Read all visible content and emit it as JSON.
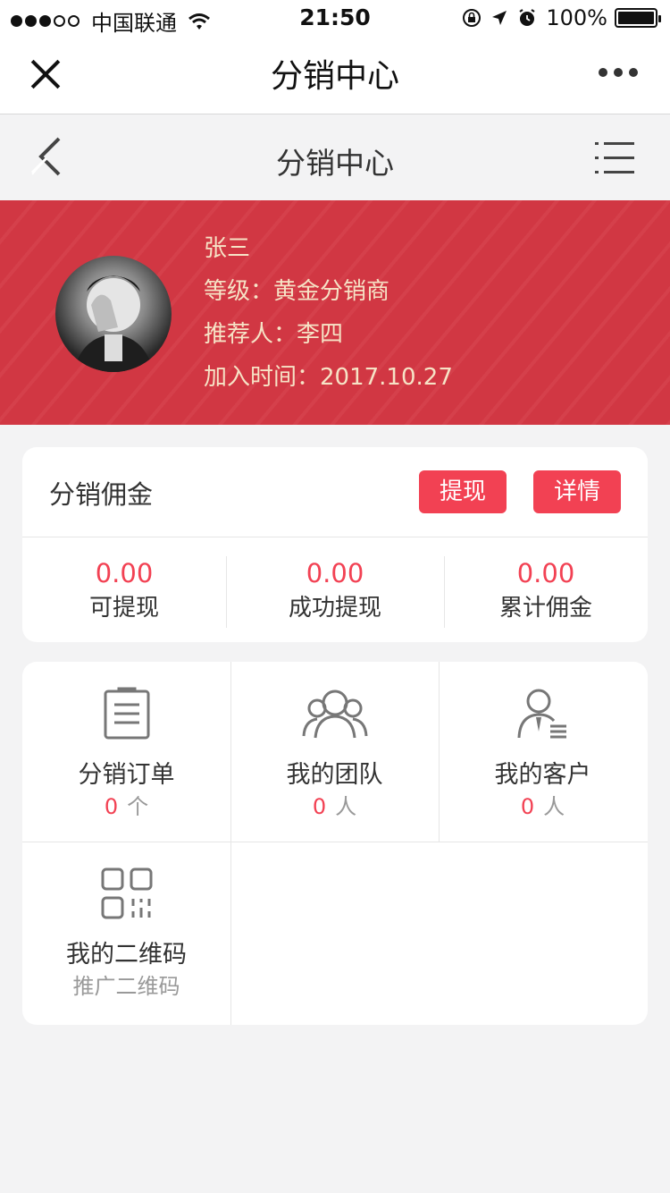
{
  "statusbar": {
    "carrier": "中国联通",
    "time": "21:50",
    "battery": "100%",
    "icons": [
      "signal-dots-icon",
      "wifi-icon",
      "rotation-lock-icon",
      "location-arrow-icon",
      "alarm-icon",
      "battery-icon"
    ]
  },
  "wechat_nav": {
    "title": "分销中心",
    "icons": [
      "close-icon",
      "more-dots-icon"
    ]
  },
  "page_header": {
    "title": "分销中心",
    "icons": [
      "back-chevron-icon",
      "list-menu-icon"
    ]
  },
  "profile": {
    "name": "张三",
    "level": "等级：黄金分销商",
    "referrer": "推荐人：李四",
    "join_date": "加入时间：2017.10.27",
    "banner_color": "#d13743",
    "text_color": "#f6e3c6"
  },
  "commission": {
    "title": "分销佣金",
    "withdraw_button": "提现",
    "detail_button": "详情",
    "accent": "#f24153",
    "stats": [
      {
        "value": "0.00",
        "label": "可提现"
      },
      {
        "value": "0.00",
        "label": "成功提现"
      },
      {
        "value": "0.00",
        "label": "累计佣金"
      }
    ]
  },
  "grid": [
    {
      "name": "分销订单",
      "count": "0",
      "unit": "个",
      "icon": "order-list-icon"
    },
    {
      "name": "我的团队",
      "count": "0",
      "unit": "人",
      "icon": "team-icon"
    },
    {
      "name": "我的客户",
      "count": "0",
      "unit": "人",
      "icon": "customer-icon"
    },
    {
      "name": "我的二维码",
      "sub": "推广二维码",
      "icon": "qr-code-icon"
    }
  ]
}
